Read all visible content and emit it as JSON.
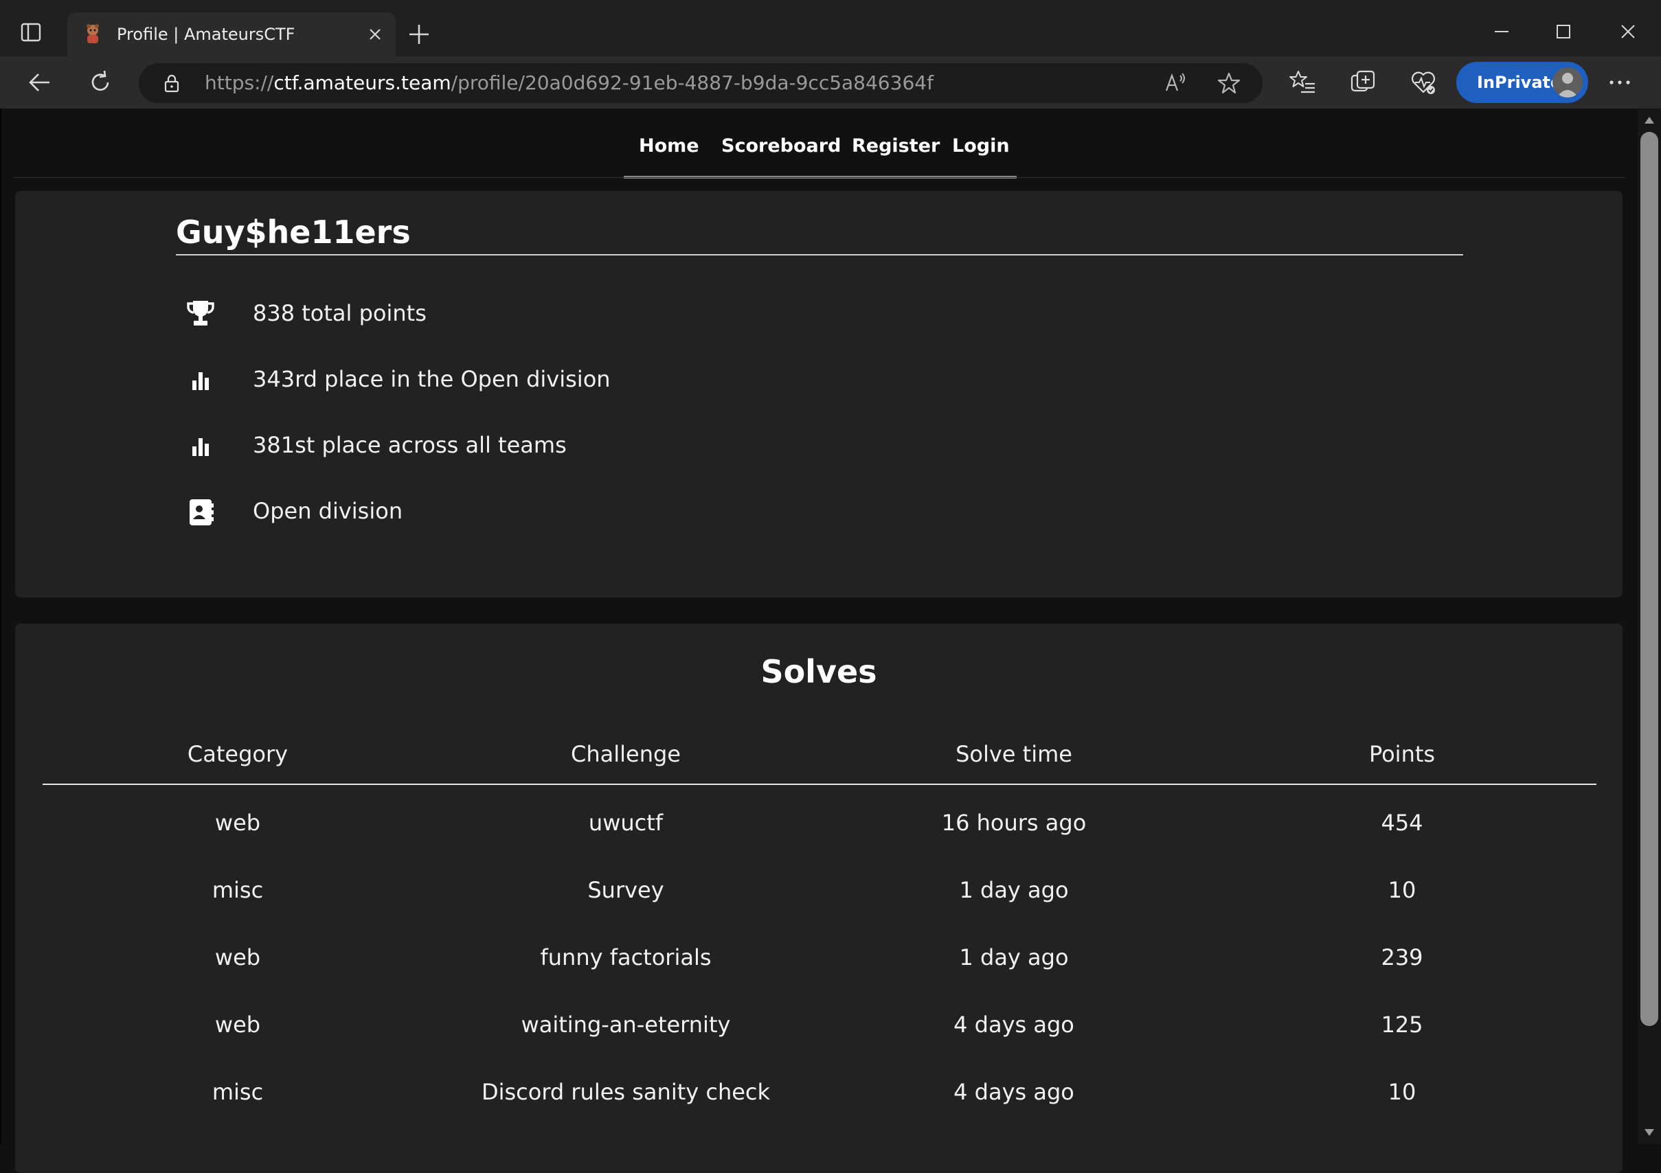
{
  "browser": {
    "tab_title": "Profile | AmateursCTF",
    "url_prefix": "https://",
    "url_host": "ctf.amateurs.team",
    "url_path": "/profile/20a0d692-91eb-4887-b9da-9cc5a846364f",
    "inprivate_label": "InPrivate",
    "accent_color": "#1f5fbf"
  },
  "site_nav": {
    "links": [
      "Home",
      "Scoreboard",
      "Register",
      "Login"
    ]
  },
  "profile": {
    "team_name": "Guy$he11ers",
    "stats": [
      {
        "icon": "trophy-icon",
        "text": "838 total points"
      },
      {
        "icon": "bar-chart-icon",
        "text": "343rd place in the Open division"
      },
      {
        "icon": "bar-chart-icon",
        "text": "381st place across all teams"
      },
      {
        "icon": "contact-card-icon",
        "text": "Open division"
      }
    ]
  },
  "solves": {
    "title": "Solves",
    "columns": [
      "Category",
      "Challenge",
      "Solve time",
      "Points"
    ],
    "rows": [
      [
        "web",
        "uwuctf",
        "16 hours ago",
        "454"
      ],
      [
        "misc",
        "Survey",
        "1 day ago",
        "10"
      ],
      [
        "web",
        "funny factorials",
        "1 day ago",
        "239"
      ],
      [
        "web",
        "waiting-an-eternity",
        "4 days ago",
        "125"
      ],
      [
        "misc",
        "Discord rules sanity check",
        "4 days ago",
        "10"
      ]
    ]
  }
}
